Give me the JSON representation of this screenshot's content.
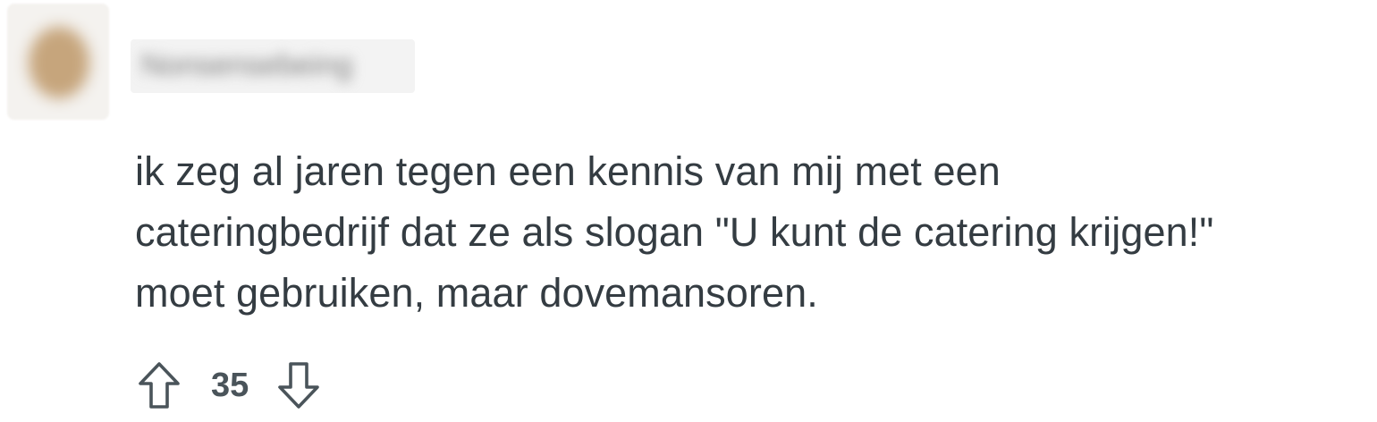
{
  "comment": {
    "author": "Nonsensebeing",
    "body_lines": [
      "ik zeg al jaren tegen een kennis van mij met een",
      "cateringbedrijf dat ze als slogan \"U kunt de catering krijgen!\"",
      "moet gebruiken, maar dovemansoren."
    ],
    "score": "35"
  },
  "icons": {
    "upvote": "arrow-up-outline-icon",
    "downvote": "arrow-down-outline-icon"
  },
  "colors": {
    "text": "#343c42",
    "icon": "#4a545a",
    "avatar": "#c6a57c"
  }
}
